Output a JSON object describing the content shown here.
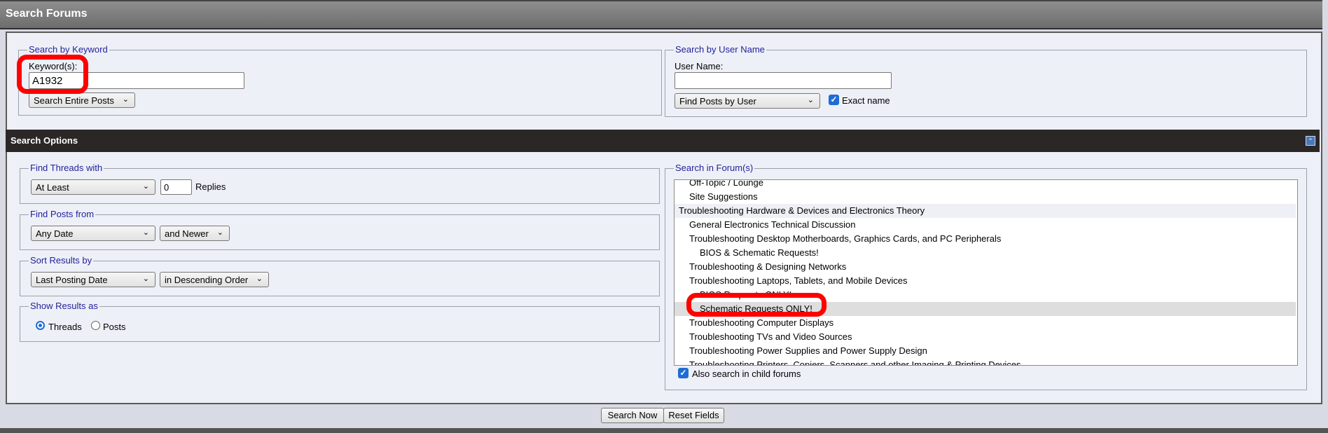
{
  "title": "Search Forums",
  "keyword_section": {
    "legend": "Search by Keyword",
    "label": "Keyword(s):",
    "value": "A1932",
    "scope_select": "Search Entire Posts"
  },
  "user_section": {
    "legend": "Search by User Name",
    "label": "User Name:",
    "value": "",
    "mode_select": "Find Posts by User",
    "exact_name_label": "Exact name",
    "exact_name_checked": true
  },
  "options": {
    "title": "Search Options",
    "threads": {
      "legend": "Find Threads with",
      "select": "At Least",
      "value": "0",
      "suffix": "Replies"
    },
    "posts_from": {
      "legend": "Find Posts from",
      "date_select": "Any Date",
      "range_select": "and Newer"
    },
    "sort": {
      "legend": "Sort Results by",
      "field_select": "Last Posting Date",
      "order_select": "in Descending Order"
    },
    "show_as": {
      "legend": "Show Results as",
      "threads_label": "Threads",
      "posts_label": "Posts",
      "selected": "Threads"
    }
  },
  "forums": {
    "legend": "Search in Forum(s)",
    "items": [
      {
        "label": "Off-Topic / Lounge",
        "level": 1
      },
      {
        "label": "Site Suggestions",
        "level": 1
      },
      {
        "label": "Troubleshooting Hardware & Devices and Electronics Theory",
        "level": 0
      },
      {
        "label": "General Electronics Technical Discussion",
        "level": 1
      },
      {
        "label": "Troubleshooting Desktop Motherboards, Graphics Cards, and PC Peripherals",
        "level": 1
      },
      {
        "label": "BIOS & Schematic Requests!",
        "level": 2
      },
      {
        "label": "Troubleshooting & Designing Networks",
        "level": 1
      },
      {
        "label": "Troubleshooting Laptops, Tablets, and Mobile Devices",
        "level": 1
      },
      {
        "label": "BIOS Requests ONLY!",
        "level": 2
      },
      {
        "label": "Schematic Requests ONLY!",
        "level": 2,
        "selected": true
      },
      {
        "label": "Troubleshooting Computer Displays",
        "level": 1
      },
      {
        "label": "Troubleshooting TVs and Video Sources",
        "level": 1
      },
      {
        "label": "Troubleshooting Power Supplies and Power Supply Design",
        "level": 1
      },
      {
        "label": "Troubleshooting Printers, Copiers, Scanners and other Imaging & Printing Devices",
        "level": 1
      }
    ],
    "child_label": "Also search in child forums",
    "child_checked": true
  },
  "buttons": {
    "search": "Search Now",
    "reset": "Reset Fields"
  },
  "colors": {
    "legend_text": "#22229a",
    "highlight": "#ff0000",
    "checkbox": "#1f6dd4"
  }
}
